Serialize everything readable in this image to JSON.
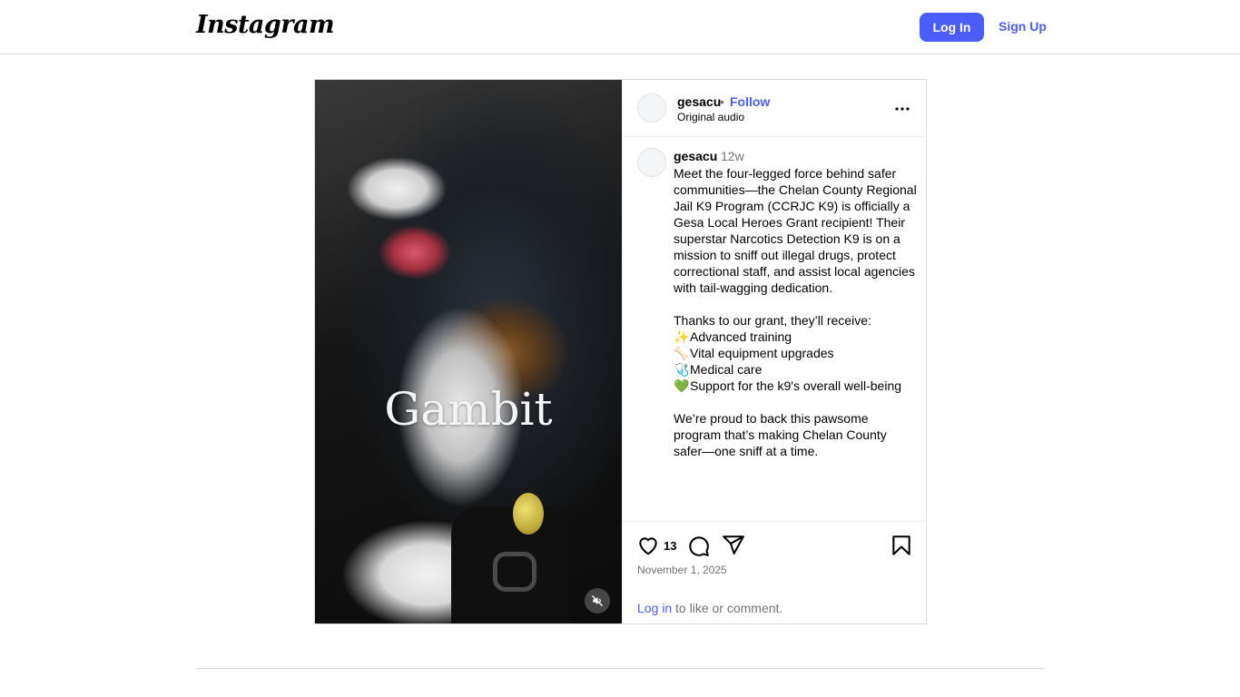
{
  "header": {
    "logo_text": "Instagram",
    "login_label": "Log In",
    "signup_label": "Sign Up"
  },
  "media": {
    "overlay_text": "Gambit"
  },
  "post_header": {
    "username": "gesacu",
    "separator": "•",
    "follow_label": "Follow",
    "audio_label": "Original audio"
  },
  "caption": {
    "username": "gesacu",
    "time": "12w",
    "paragraph1": "Meet the four-legged force behind safer communities—the Chelan County Regional Jail K9 Program (CCRJC K9) is officially a Gesa Local Heroes Grant recipient! Their superstar Narcotics Detection K9 is on a mission to sniff out illegal drugs, protect correctional staff, and assist local agencies with tail-wagging dedication.",
    "intro": "Thanks to our grant, they’ll receive:",
    "bullets": [
      {
        "emoji": "✨",
        "text": "Advanced training"
      },
      {
        "emoji": "🦴",
        "text": "Vital equipment upgrades"
      },
      {
        "emoji": "🩺",
        "text": "Medical care"
      },
      {
        "emoji": "💚",
        "text": "Support for the k9's overall well-being"
      }
    ],
    "paragraph2": "We’re proud to back this pawsome program that’s making Chelan County safer—one sniff at a time."
  },
  "actions": {
    "like_count": "13",
    "date": "November 1, 2025",
    "login_link": "Log in",
    "login_suffix": " to like or comment."
  },
  "colors": {
    "accent": "#4a5df9",
    "muted_text": "#737373",
    "border": "#dbdbdb"
  },
  "icons": [
    "heart-icon",
    "comment-icon",
    "share-icon",
    "bookmark-icon",
    "more-icon",
    "add-circle-icon",
    "muted-speaker-icon"
  ]
}
